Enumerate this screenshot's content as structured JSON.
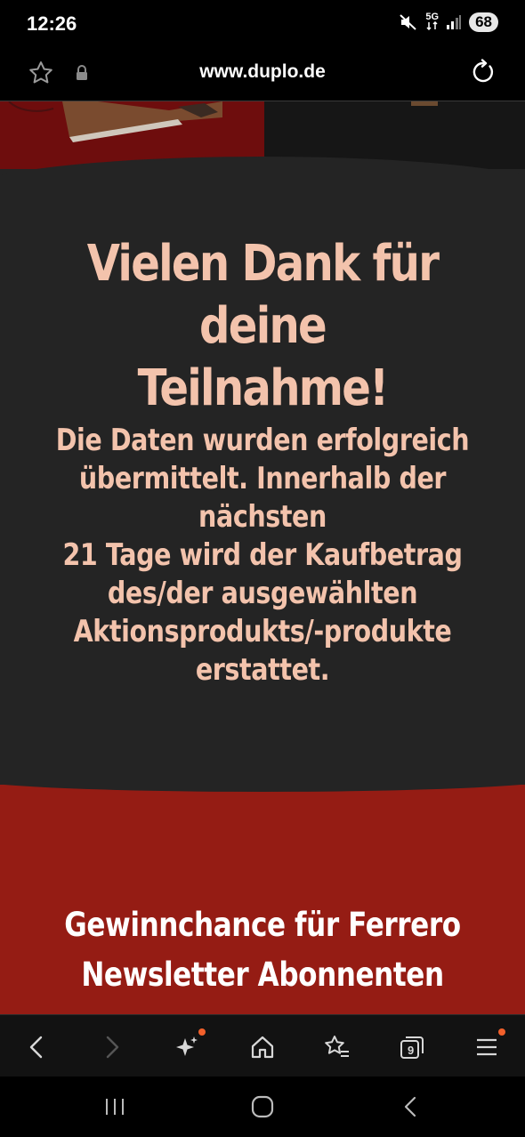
{
  "status_bar": {
    "time": "12:26",
    "network": "5G",
    "battery": "68"
  },
  "url_bar": {
    "url": "www.duplo.de"
  },
  "main": {
    "title": "Vielen Dank für deine Teilnahme!",
    "title_lines": [
      "Vielen Dank für deine",
      "Teilnahme!"
    ],
    "body_lines": [
      "Die Daten wurden erfolgreich",
      "übermittelt. Innerhalb der nächsten",
      "21 Tage wird der Kaufbetrag",
      "des/der ausgewählten",
      "Aktionsprodukts/-produkte",
      "erstattet."
    ]
  },
  "promo": {
    "lines": [
      "Gewinnchance für Ferrero",
      "Newsletter Abonnenten"
    ]
  },
  "toolbar": {
    "tabs_count": "9",
    "icons": [
      "back-icon",
      "forward-icon",
      "ai-sparkle-icon",
      "home-icon",
      "bookmarks-icon",
      "tabs-icon",
      "menu-icon"
    ]
  },
  "colors": {
    "page_bg": "#242424",
    "accent_text": "#f3c3ac",
    "promo_bg": "#951c14",
    "notification_dot": "#f2602b"
  }
}
